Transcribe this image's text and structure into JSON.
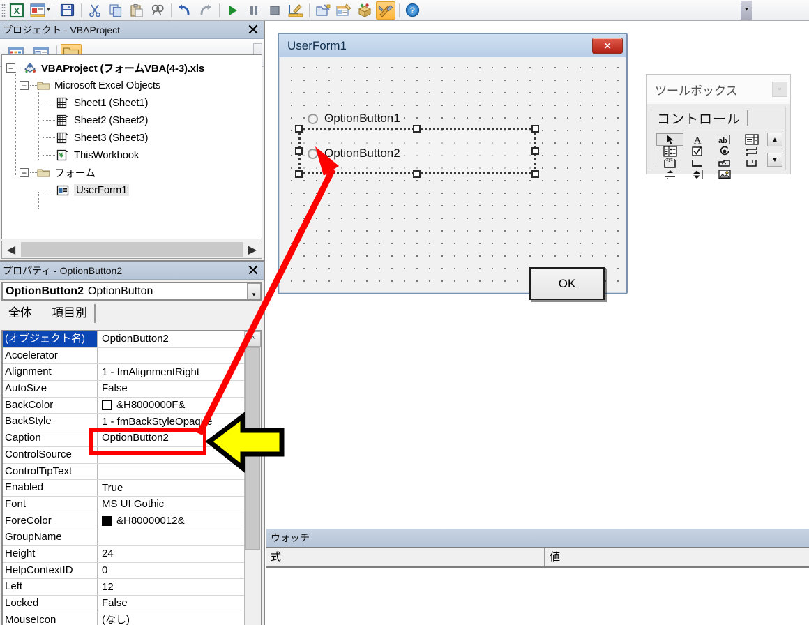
{
  "toolbar": {
    "items": [
      {
        "name": "excel-icon",
        "glyph": "X",
        "label": "Microsoft Excel の表示",
        "active": false
      },
      {
        "name": "insert-userform-icon",
        "glyph": "▤",
        "label": "ユーザーフォームの挿入",
        "active": false
      },
      {
        "name": "save-icon",
        "glyph": "💾",
        "label": "上書き保存",
        "active": false
      },
      {
        "name": "cut-icon",
        "glyph": "✂",
        "label": "切り取り",
        "active": false
      },
      {
        "name": "copy-icon",
        "glyph": "⧉",
        "label": "コピー",
        "active": false
      },
      {
        "name": "paste-icon",
        "glyph": "📋",
        "label": "貼り付け",
        "active": false
      },
      {
        "name": "find-icon",
        "glyph": "🔍",
        "label": "検索",
        "active": false
      },
      {
        "name": "undo-icon",
        "glyph": "↰",
        "label": "元に戻す",
        "active": false
      },
      {
        "name": "redo-icon",
        "glyph": "↱",
        "label": "やり直し",
        "active": false
      },
      {
        "name": "run-icon",
        "glyph": "▶",
        "label": "Sub/ユーザーフォームの実行",
        "active": false
      },
      {
        "name": "pause-icon",
        "glyph": "❚❚",
        "label": "中断",
        "active": false
      },
      {
        "name": "stop-icon",
        "glyph": "■",
        "label": "リセット",
        "active": false
      },
      {
        "name": "design-mode-icon",
        "glyph": "📐",
        "label": "デザインモード",
        "active": false
      },
      {
        "name": "project-explorer-icon",
        "glyph": "🗂",
        "label": "プロジェクト エクスプローラー",
        "active": false
      },
      {
        "name": "properties-window-icon",
        "glyph": "🗔",
        "label": "プロパティ ウィンドウ",
        "active": false
      },
      {
        "name": "object-browser-icon",
        "glyph": "📦",
        "label": "オブジェクト ブラウザー",
        "active": false
      },
      {
        "name": "toolbox-icon",
        "glyph": "🛠",
        "label": "ツールボックス",
        "active": true
      },
      {
        "name": "help-icon",
        "glyph": "?",
        "label": "ヘルプ",
        "active": false
      }
    ],
    "overflow_label": "その他のボタン"
  },
  "project_panel": {
    "title": "プロジェクト - VBAProject",
    "close_label": "✕",
    "buttons": [
      {
        "name": "view-code-button",
        "label": "コードの表示"
      },
      {
        "name": "view-object-button",
        "label": "オブジェクトの表示"
      },
      {
        "name": "toggle-folders-button",
        "label": "フォルダーの切り替え"
      }
    ],
    "tree": {
      "root": {
        "label": "VBAProject (フォームVBA(4-3).xls",
        "icon": "vbaproject-icon",
        "expanded": true
      },
      "groups": [
        {
          "label": "Microsoft Excel Objects",
          "icon": "folder-icon",
          "expanded": true,
          "children": [
            {
              "label": "Sheet1 (Sheet1)",
              "icon": "worksheet-icon",
              "selected": false
            },
            {
              "label": "Sheet2 (Sheet2)",
              "icon": "worksheet-icon",
              "selected": false
            },
            {
              "label": "Sheet3 (Sheet3)",
              "icon": "worksheet-icon",
              "selected": false
            },
            {
              "label": "ThisWorkbook",
              "icon": "workbook-icon",
              "selected": false
            }
          ]
        },
        {
          "label": "フォーム",
          "icon": "folder-icon",
          "expanded": true,
          "children": [
            {
              "label": "UserForm1",
              "icon": "userform-icon",
              "selected": true
            }
          ]
        }
      ]
    },
    "scroll_left_label": "◀",
    "scroll_right_label": "▶"
  },
  "properties_panel": {
    "title": "プロパティ - OptionButton2",
    "close_label": "✕",
    "object_name": "OptionButton2",
    "object_type": "OptionButton",
    "dropdown_label": "▾",
    "tabs": [
      {
        "label": "全体",
        "active": true
      },
      {
        "label": "項目別",
        "active": false
      }
    ],
    "rows": [
      {
        "key": "(オブジェクト名)",
        "value": "OptionButton2",
        "highlight": true,
        "swatch": null
      },
      {
        "key": "Accelerator",
        "value": "",
        "highlight": false,
        "swatch": null
      },
      {
        "key": "Alignment",
        "value": "1 - fmAlignmentRight",
        "highlight": false,
        "swatch": null
      },
      {
        "key": "AutoSize",
        "value": "False",
        "highlight": false,
        "swatch": null
      },
      {
        "key": "BackColor",
        "value": "&H8000000F&",
        "highlight": false,
        "swatch": "#ffffff"
      },
      {
        "key": "BackStyle",
        "value": "1 - fmBackStyleOpaque",
        "highlight": false,
        "swatch": null
      },
      {
        "key": "Caption",
        "value": "OptionButton2",
        "highlight": false,
        "swatch": null
      },
      {
        "key": "ControlSource",
        "value": "",
        "highlight": false,
        "swatch": null
      },
      {
        "key": "ControlTipText",
        "value": "",
        "highlight": false,
        "swatch": null
      },
      {
        "key": "Enabled",
        "value": "True",
        "highlight": false,
        "swatch": null
      },
      {
        "key": "Font",
        "value": "MS UI Gothic",
        "highlight": false,
        "swatch": null
      },
      {
        "key": "ForeColor",
        "value": "&H80000012&",
        "highlight": false,
        "swatch": "#000000"
      },
      {
        "key": "GroupName",
        "value": "",
        "highlight": false,
        "swatch": null
      },
      {
        "key": "Height",
        "value": "24",
        "highlight": false,
        "swatch": null
      },
      {
        "key": "HelpContextID",
        "value": "0",
        "highlight": false,
        "swatch": null
      },
      {
        "key": "Left",
        "value": "12",
        "highlight": false,
        "swatch": null
      },
      {
        "key": "Locked",
        "value": "False",
        "highlight": false,
        "swatch": null
      },
      {
        "key": "MouseIcon",
        "value": "(なし)",
        "highlight": false,
        "swatch": null
      }
    ],
    "scroll_up_label": "^",
    "scroll_down_label": "v"
  },
  "userform": {
    "title": "UserForm1",
    "close_label": "✕",
    "controls": [
      {
        "name": "option-button-1",
        "caption": "OptionButton1",
        "selected": false
      },
      {
        "name": "option-button-2",
        "caption": "OptionButton2",
        "selected": true
      }
    ],
    "ok_button_label": "OK"
  },
  "toolbox": {
    "title": "ツールボックス",
    "minimize_label": "▫",
    "tab_label": "コントロール",
    "controls": [
      {
        "name": "select-objects-icon",
        "glyph": "➤",
        "label": "オブジェクトの選択",
        "selected": true
      },
      {
        "name": "label-icon",
        "glyph": "A",
        "label": "ラベル",
        "selected": false
      },
      {
        "name": "textbox-icon",
        "glyph": "abl",
        "label": "テキスト ボックス",
        "selected": false
      },
      {
        "name": "combobox-icon",
        "glyph": "▤",
        "label": "コンボ ボックス",
        "selected": false
      },
      {
        "name": "listbox-icon",
        "glyph": "☰",
        "label": "リスト ボックス",
        "selected": false
      },
      {
        "name": "checkbox-icon",
        "glyph": "☑",
        "label": "チェック ボックス",
        "selected": false
      },
      {
        "name": "optionbutton-icon",
        "glyph": "◉",
        "label": "オプション ボタン",
        "selected": false
      },
      {
        "name": "togglebutton-icon",
        "glyph": "⇄",
        "label": "トグル ボタン",
        "selected": false
      },
      {
        "name": "frame-icon",
        "glyph": "xyz",
        "label": "フレーム",
        "selected": false
      },
      {
        "name": "commandbutton-icon",
        "glyph": "⌐",
        "label": "コマンド ボタン",
        "selected": false
      },
      {
        "name": "tabstrip-icon",
        "glyph": "⌒",
        "label": "タブ ストリップ",
        "selected": false
      },
      {
        "name": "multipage-icon",
        "glyph": "⌐",
        "label": "マルチページ",
        "selected": false
      },
      {
        "name": "scrollbar-icon",
        "glyph": "▲",
        "label": "スクロール バー",
        "selected": false
      },
      {
        "name": "spinbutton-icon",
        "glyph": "⬍",
        "label": "スピン ボタン",
        "selected": false
      },
      {
        "name": "image-icon",
        "glyph": "🖼",
        "label": "イメージ",
        "selected": false
      }
    ],
    "scroll_up_label": "▲",
    "scroll_down_label": "▼"
  },
  "watch_window": {
    "title": "ウォッチ",
    "columns": [
      {
        "label": "式"
      },
      {
        "label": "値"
      }
    ],
    "rows": []
  },
  "annotations": {
    "red_arrow": {
      "name": "red-arrow",
      "from": "caption-property-row",
      "to": "option-button-2-on-form",
      "color": "#ff0000"
    },
    "red_rect": {
      "name": "red-highlight-rect",
      "target": "caption-property-value",
      "color": "#ff0000"
    },
    "yellow_arrow": {
      "name": "yellow-callout-arrow",
      "direction": "left",
      "fill": "#ffff00",
      "outline": "#000000"
    }
  }
}
